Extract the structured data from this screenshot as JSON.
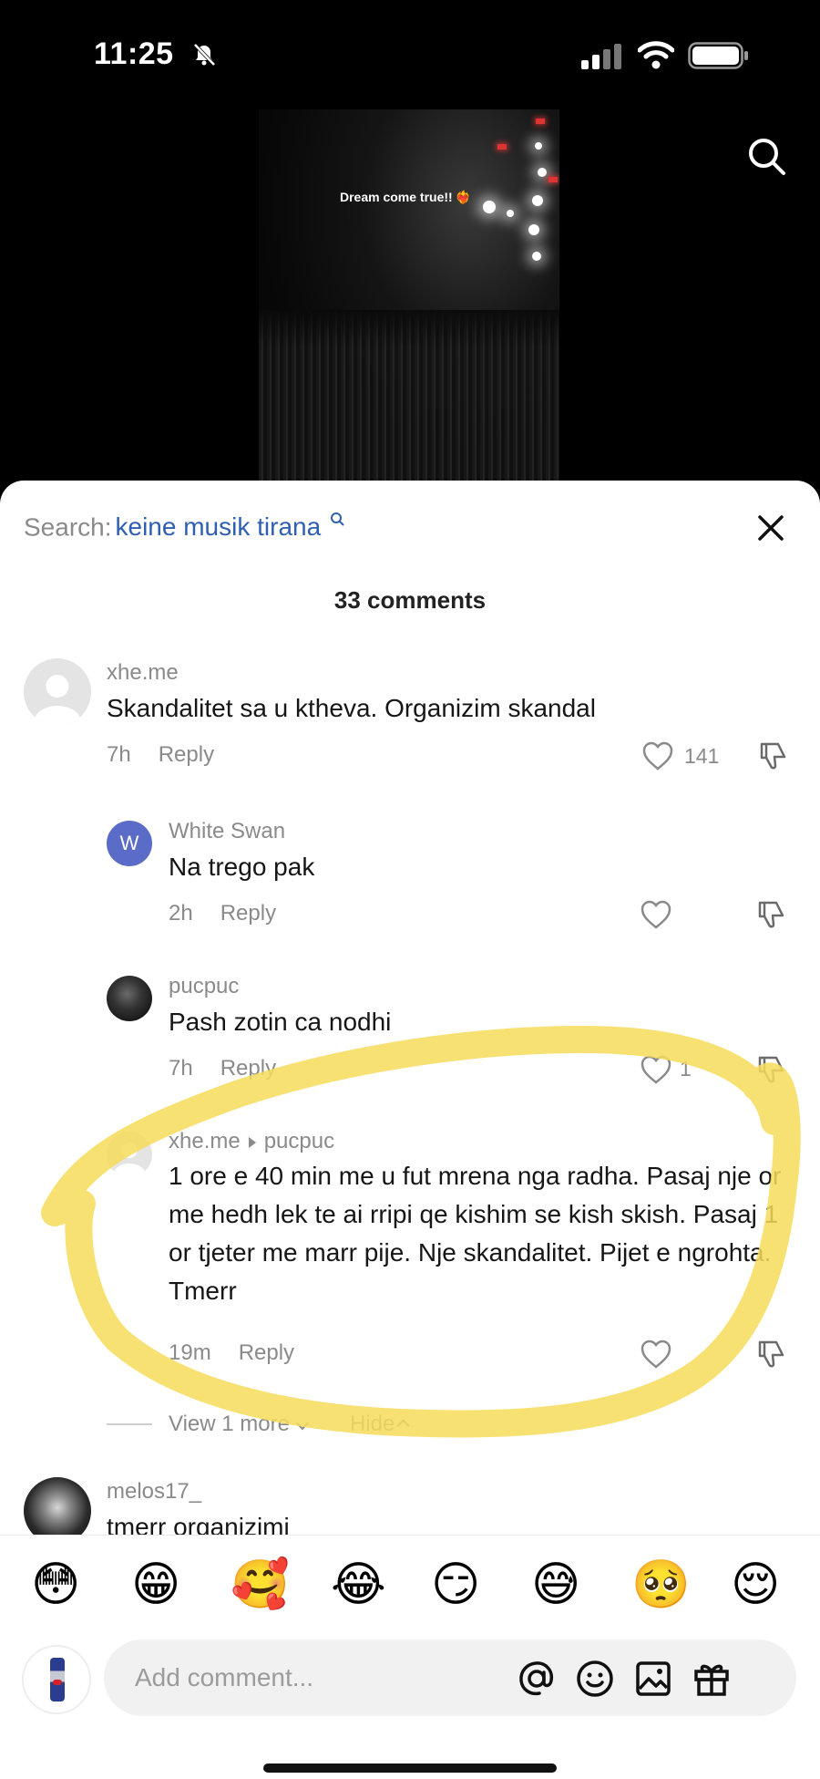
{
  "status_bar": {
    "time": "11:25"
  },
  "video": {
    "caption": "Dream come true!!",
    "caption_emoji": "❤️‍🔥"
  },
  "search": {
    "label": "Search:",
    "term": "keine musik tirana"
  },
  "comments_header": {
    "count_text": "33 comments"
  },
  "comments": [
    {
      "username": "xhe.me",
      "text": "Skandalitet sa u ktheva. Organizim skandal",
      "time": "7h",
      "reply_label": "Reply",
      "likes": "141"
    },
    {
      "username": "White Swan",
      "avatar_letter": "W",
      "text": "Na trego pak",
      "time": "2h",
      "reply_label": "Reply",
      "likes": ""
    },
    {
      "username": "pucpuc",
      "text": "Pash zotin ca nodhi",
      "time": "7h",
      "reply_label": "Reply",
      "likes": "1"
    },
    {
      "username": "xhe.me",
      "reply_to": "pucpuc",
      "text": "1 ore e 40 min me u fut mrena nga radha. Pasaj nje or me hedh lek te ai rripi qe kishim se kish skish. Pasaj 1 or tjeter me marr pije. Nje skandalitet. Pijet e ngrohta. Tmerr",
      "time": "19m",
      "reply_label": "Reply",
      "likes": ""
    },
    {
      "username": "melos17_",
      "text": "tmerr organizimi"
    }
  ],
  "thread_controls": {
    "view_more": "View 1 more",
    "hide": "Hide"
  },
  "emoji_bar": [
    "😳",
    "😁",
    "🥰",
    "😂",
    "😏",
    "😅",
    "🥺",
    "😌"
  ],
  "composer": {
    "placeholder": "Add comment..."
  },
  "highlight_color": "#f7dc5a"
}
